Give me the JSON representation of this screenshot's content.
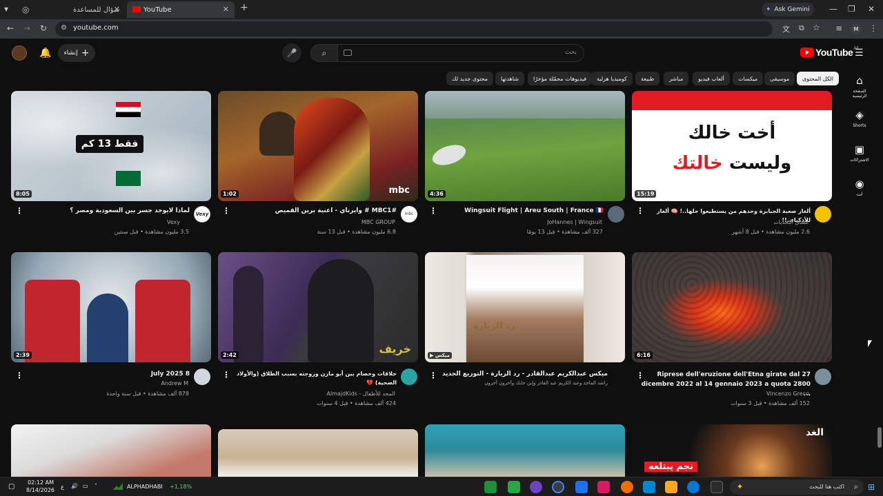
{
  "browser": {
    "tabs": [
      {
        "title": "سؤال للمساعدة"
      },
      {
        "title": "YouTube"
      }
    ],
    "new_tab_symbol": "+",
    "ask_gemini": "Ask Gemini",
    "url": "youtube.com",
    "profile_initial": "M"
  },
  "header": {
    "create_label": "إنشاء",
    "search_placeholder": "بحث",
    "logo_text": "YouTube",
    "country_code": "AE"
  },
  "chips": [
    "الكل المحتوى",
    "موسيقى",
    "ميكسات",
    "ألعاب فيديو",
    "مباشر",
    "طبيعة",
    "كوميديا هزلية",
    "فيديوهات محمّلة مؤخرًا",
    "شاهدتها",
    "محتوى جديد لك"
  ],
  "guide": [
    {
      "label": "الصفحة الرئيسية",
      "icon": "home-icon"
    },
    {
      "label": "Shorts",
      "icon": "shorts-icon"
    },
    {
      "label": "الاشتراكات",
      "icon": "subscriptions-icon"
    },
    {
      "label": "أنت",
      "icon": "you-icon"
    }
  ],
  "videos": [
    {
      "title": "لماذا لايوجد جسر بين السعودية ومصر ؟",
      "channel": "Vexy",
      "meta": "3.5 مليون مشاهدة • قبل سنتين",
      "duration": "8:05",
      "thumb_text": "فقط 13 كم"
    },
    {
      "title": "#MBC1 # وايرناي - اعنية برين القميص",
      "channel": "MBC GROUP",
      "meta": "6.8 مليون مشاهدة • قبل 13 سنة",
      "duration": "1:02",
      "thumb_text": "mbc"
    },
    {
      "title": "Wingsuit Flight | Areu South | France 🇫🇷",
      "channel": "JoHannes | Wingsuit",
      "meta": "327 ألف مشاهدة • قبل 13 يومًا",
      "duration": "4:36",
      "thumb_text": ""
    },
    {
      "title": "ألغاز صعبة الجبابرة وحدهم من يستطيعوا حلها..! 🧠 ألغاز للأذكياء..!!",
      "channel": "عشاق التحديات",
      "meta": "2.6 مليون مشاهدة • قبل 8 أشهر",
      "duration": "15:19",
      "thumb_text": "ألغاز للأذكياء",
      "thumb_line1": "أخت خالك",
      "thumb_line2": "وليست",
      "thumb_line3": "خالتك"
    },
    {
      "title": "8 July 2025",
      "channel": "Andrew M",
      "meta": "878 ألف مشاهدة • قبل سنة واحدة",
      "duration": "2:39",
      "thumb_text": ""
    },
    {
      "title": "خلافات وخصام بين أبو مازن وزوجته بسبب الطلاق (والأولاد الضحية) 💔",
      "channel": "المجد للأطفال - AlmajdKids",
      "meta": "424 ألف مشاهدة • قبل 4 سنوات",
      "duration": "2:42",
      "thumb_text": "خريف"
    },
    {
      "title": "ميكس عبدالكريم عبدالقادر - رد الزيارة - التوزيع الجديد",
      "channel": "راشد الماجد وعبد الكريم عبد القادر وإبن حايك وآخرون آخرون",
      "meta": "",
      "duration": "ميكس",
      "thumb_text": "رد الزيارة"
    },
    {
      "title": "Riprese dell'eruzione dell'Etna girate dal 27 dicembre 2022 al 14 gennaio 2023 a quota 2800 ...",
      "channel": "Vincenzo Greco",
      "meta": "152 ألف مشاهدة • قبل 3 سنوات",
      "duration": "6:16",
      "thumb_text": ""
    },
    {
      "title": "",
      "channel": "",
      "meta": "",
      "duration": "",
      "thumb_text": ""
    },
    {
      "title": "",
      "channel": "",
      "meta": "",
      "duration": "",
      "thumb_text": ""
    },
    {
      "title": "",
      "channel": "",
      "meta": "",
      "duration": "",
      "thumb_text": ""
    },
    {
      "title": "",
      "channel": "",
      "meta": "",
      "duration": "",
      "thumb_text": "نجم يبتلعه",
      "thumb_brand": "الغد"
    }
  ],
  "taskbar": {
    "time": "02:12 AM",
    "date": "8/14/2026",
    "stock_name": "ALPHADHABI",
    "stock_change": "+1,18%",
    "search_placeholder": "اكتب هنا للبحث",
    "lang": "ع"
  },
  "colors": {
    "accent_red": "#ff0000",
    "background": "#0f0f0f",
    "chip_bg": "#272727"
  }
}
